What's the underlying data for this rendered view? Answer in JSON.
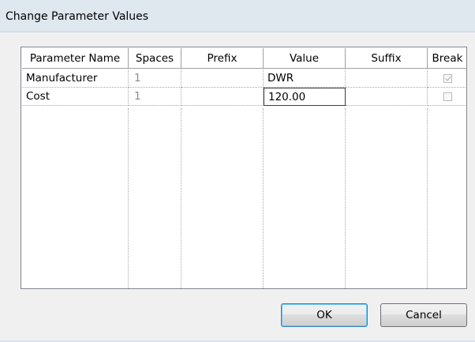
{
  "window": {
    "title": "Change Parameter Values"
  },
  "table": {
    "headers": [
      "Parameter Name",
      "Spaces",
      "Prefix",
      "Value",
      "Suffix",
      "Break"
    ],
    "rows": [
      {
        "name": "Manufacturer",
        "spaces": "1",
        "prefix": "",
        "value": "DWR",
        "suffix": "",
        "break": true
      },
      {
        "name": "Cost",
        "spaces": "1",
        "prefix": "",
        "value": "120.00",
        "suffix": "",
        "break": false
      }
    ]
  },
  "buttons": {
    "ok": "OK",
    "cancel": "Cancel"
  }
}
